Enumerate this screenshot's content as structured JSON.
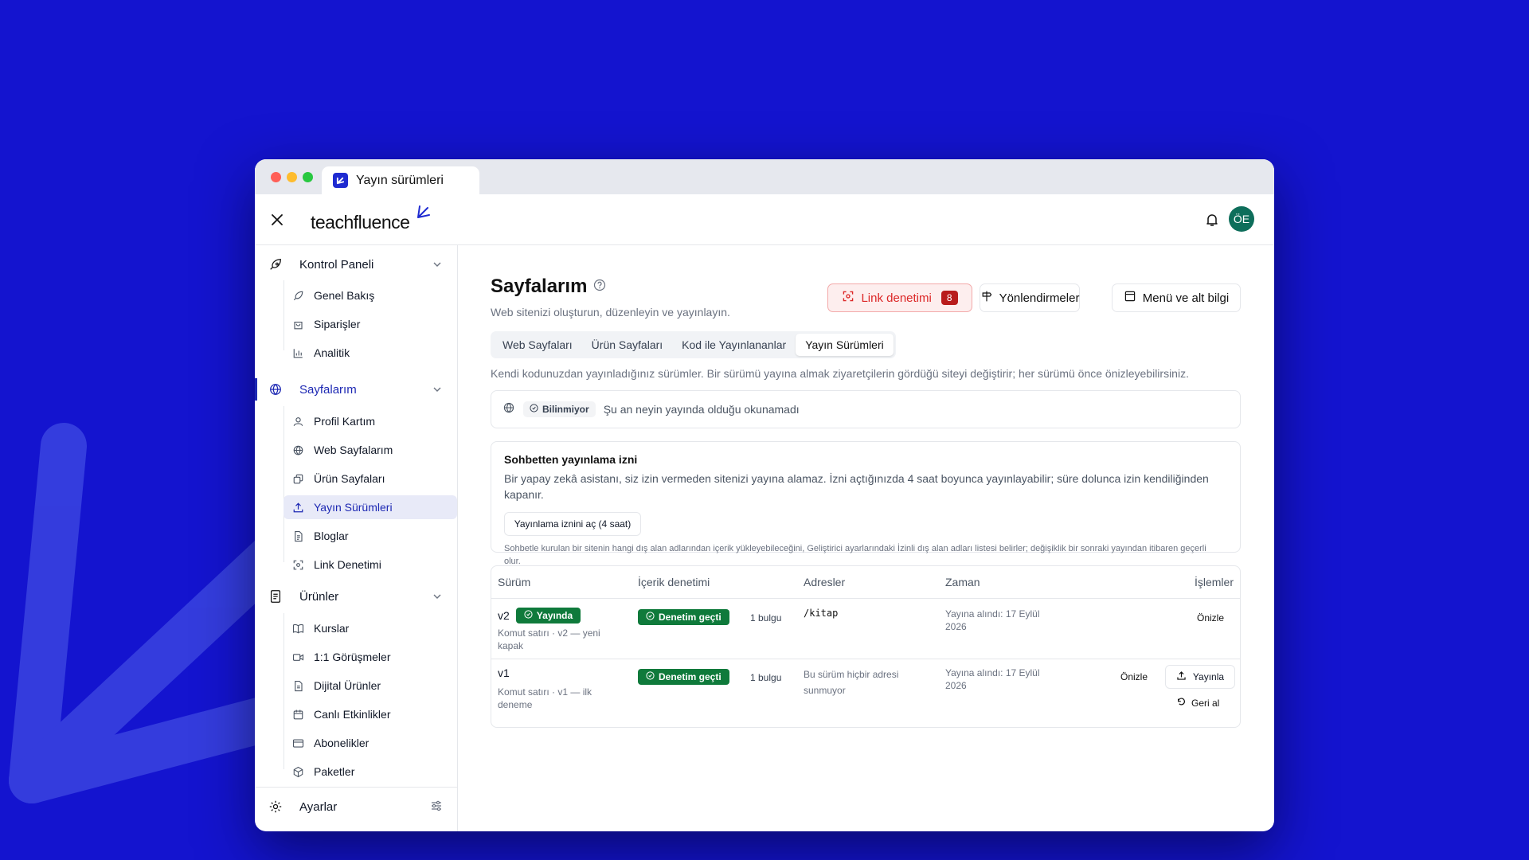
{
  "window": {
    "tab_title": "Yayın sürümleri"
  },
  "header": {
    "brand": "teachfluence",
    "avatar_initials": "ÖE"
  },
  "sidebar": {
    "sections": [
      {
        "label": "Kontrol Paneli",
        "items": [
          "Genel Bakış",
          "Siparişler",
          "Analitik"
        ]
      },
      {
        "label": "Sayfalarım",
        "items": [
          "Profil Kartım",
          "Web Sayfalarım",
          "Ürün Sayfaları",
          "Yayın Sürümleri",
          "Bloglar",
          "Link Denetimi"
        ]
      },
      {
        "label": "Ürünler",
        "items": [
          "Kurslar",
          "1:1 Görüşmeler",
          "Dijital Ürünler",
          "Canlı Etkinlikler",
          "Abonelikler",
          "Paketler"
        ]
      }
    ],
    "settings": "Ayarlar"
  },
  "page": {
    "title": "Sayfalarım",
    "subtitle": "Web sitenizi oluşturun, düzenleyin ve yayınlayın.",
    "link_audit": "Link denetimi",
    "link_audit_count": "8",
    "redirects": "Yönlendirmeler",
    "menu_footer": "Menü ve alt bilgi",
    "tabs": [
      "Web Sayfaları",
      "Ürün Sayfaları",
      "Kod ile Yayınlananlar",
      "Yayın Sürümleri"
    ],
    "description": "Kendi kodunuzdan yayınladığınız sürümler. Bir sürümü yayına almak ziyaretçilerin gördüğü siteyi değiştirir; her sürümü önce önizleyebilirsiniz.",
    "status_badge": "Bilinmiyor",
    "status_text": "Şu an neyin yayında olduğu okunamadı",
    "permission": {
      "title": "Sohbetten yayınlama izni",
      "body": "Bir yapay zekâ asistanı, siz izin vermeden sitenizi yayına alamaz. İzni açtığınızda 4 saat boyunca yayınlayabilir; süre dolunca izin kendiliğinden kapanır.",
      "button": "Yayınlama iznini aç (4 saat)",
      "note": "Sohbetle kurulan bir sitenin hangi dış alan adlarından içerik yükleyebileceğini, Geliştirici ayarlarındaki İzinli dış alan adları listesi belirler; değişiklik bir sonraki yayından itibaren geçerli olur."
    },
    "table": {
      "headers": [
        "Sürüm",
        "İçerik denetimi",
        "Adresler",
        "Zaman",
        "İşlemler"
      ],
      "rows": [
        {
          "version": "v2",
          "live": "Yayında",
          "desc": "Komut satırı · v2 — yeni kapak",
          "audit": "Denetim geçti",
          "findings": "1 bulgu",
          "address": "/kitap",
          "time": "Yayına alındı: 17 Eylül 2026",
          "preview": "Önizle"
        },
        {
          "version": "v1",
          "desc": "Komut satırı · v1 — ilk deneme",
          "audit": "Denetim geçti",
          "findings": "1 bulgu",
          "address": "Bu sürüm hiçbir adresi sunmuyor",
          "time": "Yayına alındı: 17 Eylül 2026",
          "preview": "Önizle",
          "publish": "Yayınla",
          "rollback": "Geri al"
        }
      ]
    }
  }
}
